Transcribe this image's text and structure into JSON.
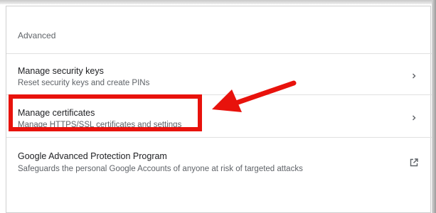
{
  "section": {
    "header": "Advanced"
  },
  "items": [
    {
      "title": "Manage security keys",
      "subtitle": "Reset security keys and create PINs",
      "action_icon": "chevron-right-icon"
    },
    {
      "title": "Manage certificates",
      "subtitle": "Manage HTTPS/SSL certificates and settings",
      "action_icon": "chevron-right-icon"
    },
    {
      "title": "Google Advanced Protection Program",
      "subtitle": "Safeguards the personal Google Accounts of anyone at risk of targeted attacks",
      "action_icon": "open-in-new-icon"
    }
  ],
  "annotation": {
    "highlight_color": "#e8120c",
    "arrow_color": "#e8120c"
  },
  "colors": {
    "title_text": "#202124",
    "secondary_text": "#5f6368",
    "divider": "#e0e0e0"
  }
}
